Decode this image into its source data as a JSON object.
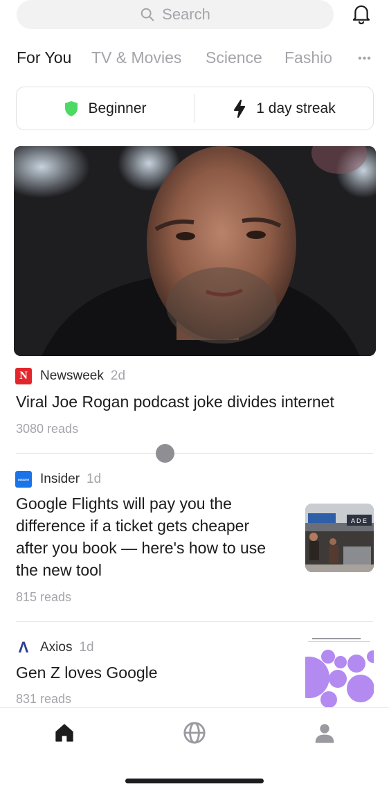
{
  "search": {
    "placeholder": "Search"
  },
  "tabs": [
    {
      "label": "For You",
      "active": true
    },
    {
      "label": "TV & Movies",
      "active": false
    },
    {
      "label": "Science",
      "active": false
    },
    {
      "label": "Fashio",
      "active": false
    }
  ],
  "more_label": "•••",
  "stats": {
    "level_label": "Beginner",
    "streak_label": "1 day streak"
  },
  "articles": [
    {
      "source": "Newsweek",
      "source_logo_text": "N",
      "age": "2d",
      "headline": "Viral Joe Rogan podcast joke divides internet",
      "reads": "3080 reads"
    },
    {
      "source": "Insider",
      "source_logo_text": "INSIDER",
      "age": "1d",
      "headline_lines": [
        "Google Flights will pay you the",
        "difference if a ticket gets cheaper",
        "after you book — here's how to use",
        "the new tool"
      ],
      "reads": "815 reads"
    },
    {
      "source": "Axios",
      "source_logo_text": "Λ",
      "age": "1d",
      "headline": "Gen Z loves Google",
      "reads": "831 reads"
    }
  ],
  "colors": {
    "accent_green": "#4cd964",
    "newsweek_red": "#e3262b",
    "insider_blue": "#1a73e8",
    "axios_navy": "#2c3e8f",
    "muted_text": "#a4a4aa"
  },
  "nav": [
    "home-icon",
    "globe-icon",
    "profile-icon"
  ]
}
